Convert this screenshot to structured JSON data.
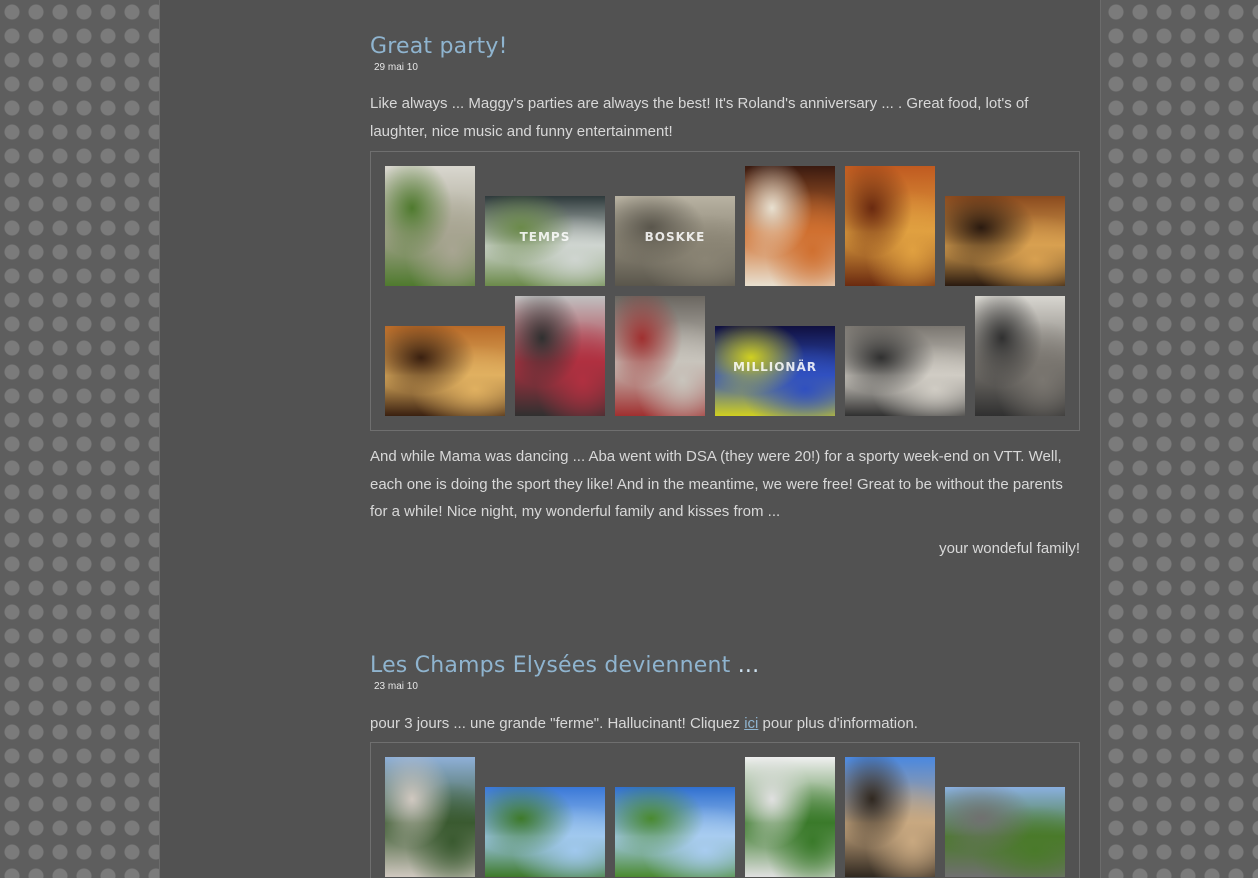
{
  "posts": [
    {
      "title": "Great party!",
      "date": "29 mai 10",
      "intro": "Like always ... Maggy's parties are always the best! It's Roland's anniversary ... . Great food, lot's of laughter, nice music and funny entertainment!",
      "body": "And while Mama was dancing ... Aba went with DSA (they were 20!) for a sporty week-end on VTT. Well, each one is doing the sport they like! And in the meantime, we were free! Great to be without the parents for a while! Nice night, my wonderful family and kisses from ...",
      "signature": "your wondeful family!",
      "photos": [
        {
          "name": "photo-plant-pot",
          "colors": [
            "#d9d7cf",
            "#a8a592",
            "#4f7a2e"
          ],
          "shows_text": ""
        },
        {
          "name": "photo-shop-display",
          "colors": [
            "#2e3a3c",
            "#cfd5d0",
            "#6b8a4a"
          ],
          "shows_text": "TEMPS"
        },
        {
          "name": "photo-boskke-box",
          "colors": [
            "#b8b2a2",
            "#8a8474",
            "#5a564c"
          ],
          "shows_text": "BOSKKE"
        },
        {
          "name": "photo-buffet-1",
          "colors": [
            "#3a1a10",
            "#d07030",
            "#e8e0d0"
          ],
          "shows_text": ""
        },
        {
          "name": "photo-buffet-2",
          "colors": [
            "#c05a20",
            "#e0a040",
            "#6a2a10"
          ],
          "shows_text": ""
        },
        {
          "name": "photo-cellar-guests",
          "colors": [
            "#8a4a1e",
            "#d8a050",
            "#2a1a10"
          ],
          "shows_text": ""
        },
        {
          "name": "photo-cellar-crowd",
          "colors": [
            "#b86a28",
            "#e0b060",
            "#3a2010"
          ],
          "shows_text": ""
        },
        {
          "name": "photo-speaker",
          "colors": [
            "#c0c0c0",
            "#b03040",
            "#303030"
          ],
          "shows_text": ""
        },
        {
          "name": "photo-stage-1",
          "colors": [
            "#6a6660",
            "#c8c4bc",
            "#a03030"
          ],
          "shows_text": ""
        },
        {
          "name": "photo-millionaire",
          "colors": [
            "#101040",
            "#3050c0",
            "#d0d020"
          ],
          "shows_text": "MILLIONÄR"
        },
        {
          "name": "photo-stage-2",
          "colors": [
            "#7a7670",
            "#d0ccc4",
            "#303030"
          ],
          "shows_text": ""
        },
        {
          "name": "photo-stage-3",
          "colors": [
            "#d8d6d0",
            "#7a7670",
            "#303030"
          ],
          "shows_text": ""
        }
      ]
    },
    {
      "title": "Les Champs Elysées deviennent",
      "title_dots": "...",
      "date": "23 mai 10",
      "text_before_link": "pour 3 jours ... une grande \"ferme\". Hallucinant! Cliquez ",
      "link": "ici",
      "text_after_link": " pour plus d'information.",
      "photos": [
        {
          "name": "photo-avenue-crowd",
          "colors": [
            "#8fb0d8",
            "#3a5a30",
            "#d0c8c0"
          ],
          "shows_text": ""
        },
        {
          "name": "photo-park-1",
          "colors": [
            "#3a78d8",
            "#a0c8ee",
            "#3e7a2a"
          ],
          "shows_text": ""
        },
        {
          "name": "photo-park-2",
          "colors": [
            "#3070d0",
            "#a8ccf0",
            "#4a8a30"
          ],
          "shows_text": ""
        },
        {
          "name": "photo-topiary",
          "colors": [
            "#f0f0f0",
            "#3a7a2a",
            "#e0e0e0"
          ],
          "shows_text": ""
        },
        {
          "name": "photo-building",
          "colors": [
            "#4a88e0",
            "#c8a880",
            "#302820"
          ],
          "shows_text": ""
        },
        {
          "name": "photo-eiffel-tower",
          "colors": [
            "#8ab0e0",
            "#4a7a2a",
            "#707070"
          ],
          "shows_text": ""
        }
      ]
    }
  ]
}
